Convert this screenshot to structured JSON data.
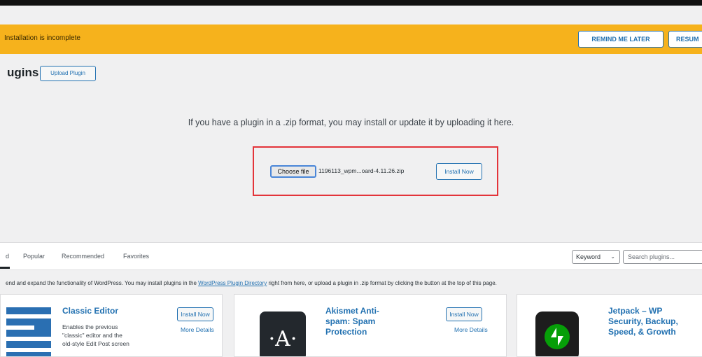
{
  "notice": {
    "text": "Installation is incomplete",
    "remind_label": "REMIND ME LATER",
    "resume_label": "RESUM"
  },
  "header": {
    "title": "ugins",
    "upload_label": "Upload Plugin"
  },
  "upload": {
    "help_text": "If you have a plugin in a .zip format, you may install or update it by uploading it here.",
    "choose_label": "Choose file",
    "filename": "1196113_wpm...oard-4.11.26.zip",
    "install_label": "Install Now"
  },
  "filters": {
    "tabs": [
      "d",
      "Popular",
      "Recommended",
      "Favorites"
    ],
    "keyword_label": "Keyword",
    "search_placeholder": "Search plugins..."
  },
  "directory_note": {
    "before": "end and expand the functionality of WordPress. You may install plugins in the ",
    "link": "WordPress Plugin Directory",
    "after": " right from here, or upload a plugin in .zip format by clicking the button at the top of this page."
  },
  "cards": [
    {
      "title": "Classic Editor",
      "desc_lines": [
        "Enables the previous",
        "\"classic\" editor and the",
        "old-style Edit Post screen"
      ],
      "install_label": "Install Now",
      "more_label": "More Details"
    },
    {
      "title_lines": [
        "Akismet Anti-",
        "spam: Spam",
        "Protection"
      ],
      "install_label": "Install Now",
      "more_label": "More Details",
      "icon_glyph": "·A·"
    },
    {
      "title_lines": [
        "Jetpack – WP",
        "Security, Backup,",
        "Speed, & Growth"
      ]
    }
  ],
  "colors": {
    "notice_bg": "#f6b21c",
    "accent": "#2271b1",
    "highlight_border": "#e3343a"
  }
}
